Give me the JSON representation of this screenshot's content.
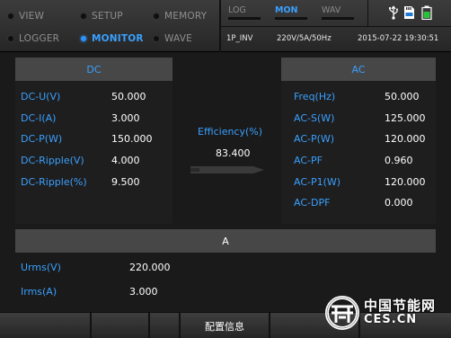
{
  "nav": {
    "items": [
      {
        "label": "VIEW",
        "active": false
      },
      {
        "label": "SETUP",
        "active": false
      },
      {
        "label": "MEMORY",
        "active": false
      },
      {
        "label": "LOGGER",
        "active": false
      },
      {
        "label": "MONITOR",
        "active": true
      },
      {
        "label": "WAVE",
        "active": false
      }
    ]
  },
  "modes": [
    {
      "label": "LOG",
      "active": false
    },
    {
      "label": "MON",
      "active": true
    },
    {
      "label": "WAV",
      "active": false
    }
  ],
  "status": {
    "mode": "1P_INV",
    "spec": "220V/5A/50Hz",
    "datetime": "2015-07-22 19:30:51"
  },
  "icons": [
    "usb-icon",
    "sd-card-icon",
    "battery-icon"
  ],
  "dc": {
    "title": "DC",
    "rows": [
      {
        "label": "DC-U(V)",
        "value": "50.000"
      },
      {
        "label": "DC-I(A)",
        "value": "3.000"
      },
      {
        "label": "DC-P(W)",
        "value": "150.000"
      },
      {
        "label": "DC-Ripple(V)",
        "value": "4.000"
      },
      {
        "label": "DC-Ripple(%)",
        "value": "9.500"
      }
    ]
  },
  "efficiency": {
    "label": "Efficiency(%)",
    "value": "83.400"
  },
  "ac": {
    "title": "AC",
    "rows": [
      {
        "label": "Freq(Hz)",
        "value": "50.000"
      },
      {
        "label": "AC-S(W)",
        "value": "125.000"
      },
      {
        "label": "AC-P(W)",
        "value": "120.000"
      },
      {
        "label": "AC-PF",
        "value": "0.960"
      },
      {
        "label": "AC-P1(W)",
        "value": "120.000"
      },
      {
        "label": "AC-DPF",
        "value": "0.000"
      }
    ]
  },
  "phase": {
    "title": "A",
    "rows": [
      {
        "label": "Urms(V)",
        "value": "220.000"
      },
      {
        "label": "Irms(A)",
        "value": "3.000"
      }
    ]
  },
  "fkeys": [
    "",
    "",
    "",
    "配置信息",
    "",
    ""
  ],
  "watermark": {
    "line1": "中国节能网",
    "line2": "CES.CN"
  },
  "colors": {
    "accent": "#3aa0ff",
    "header": "#474747",
    "background": "#1a1a1a"
  }
}
